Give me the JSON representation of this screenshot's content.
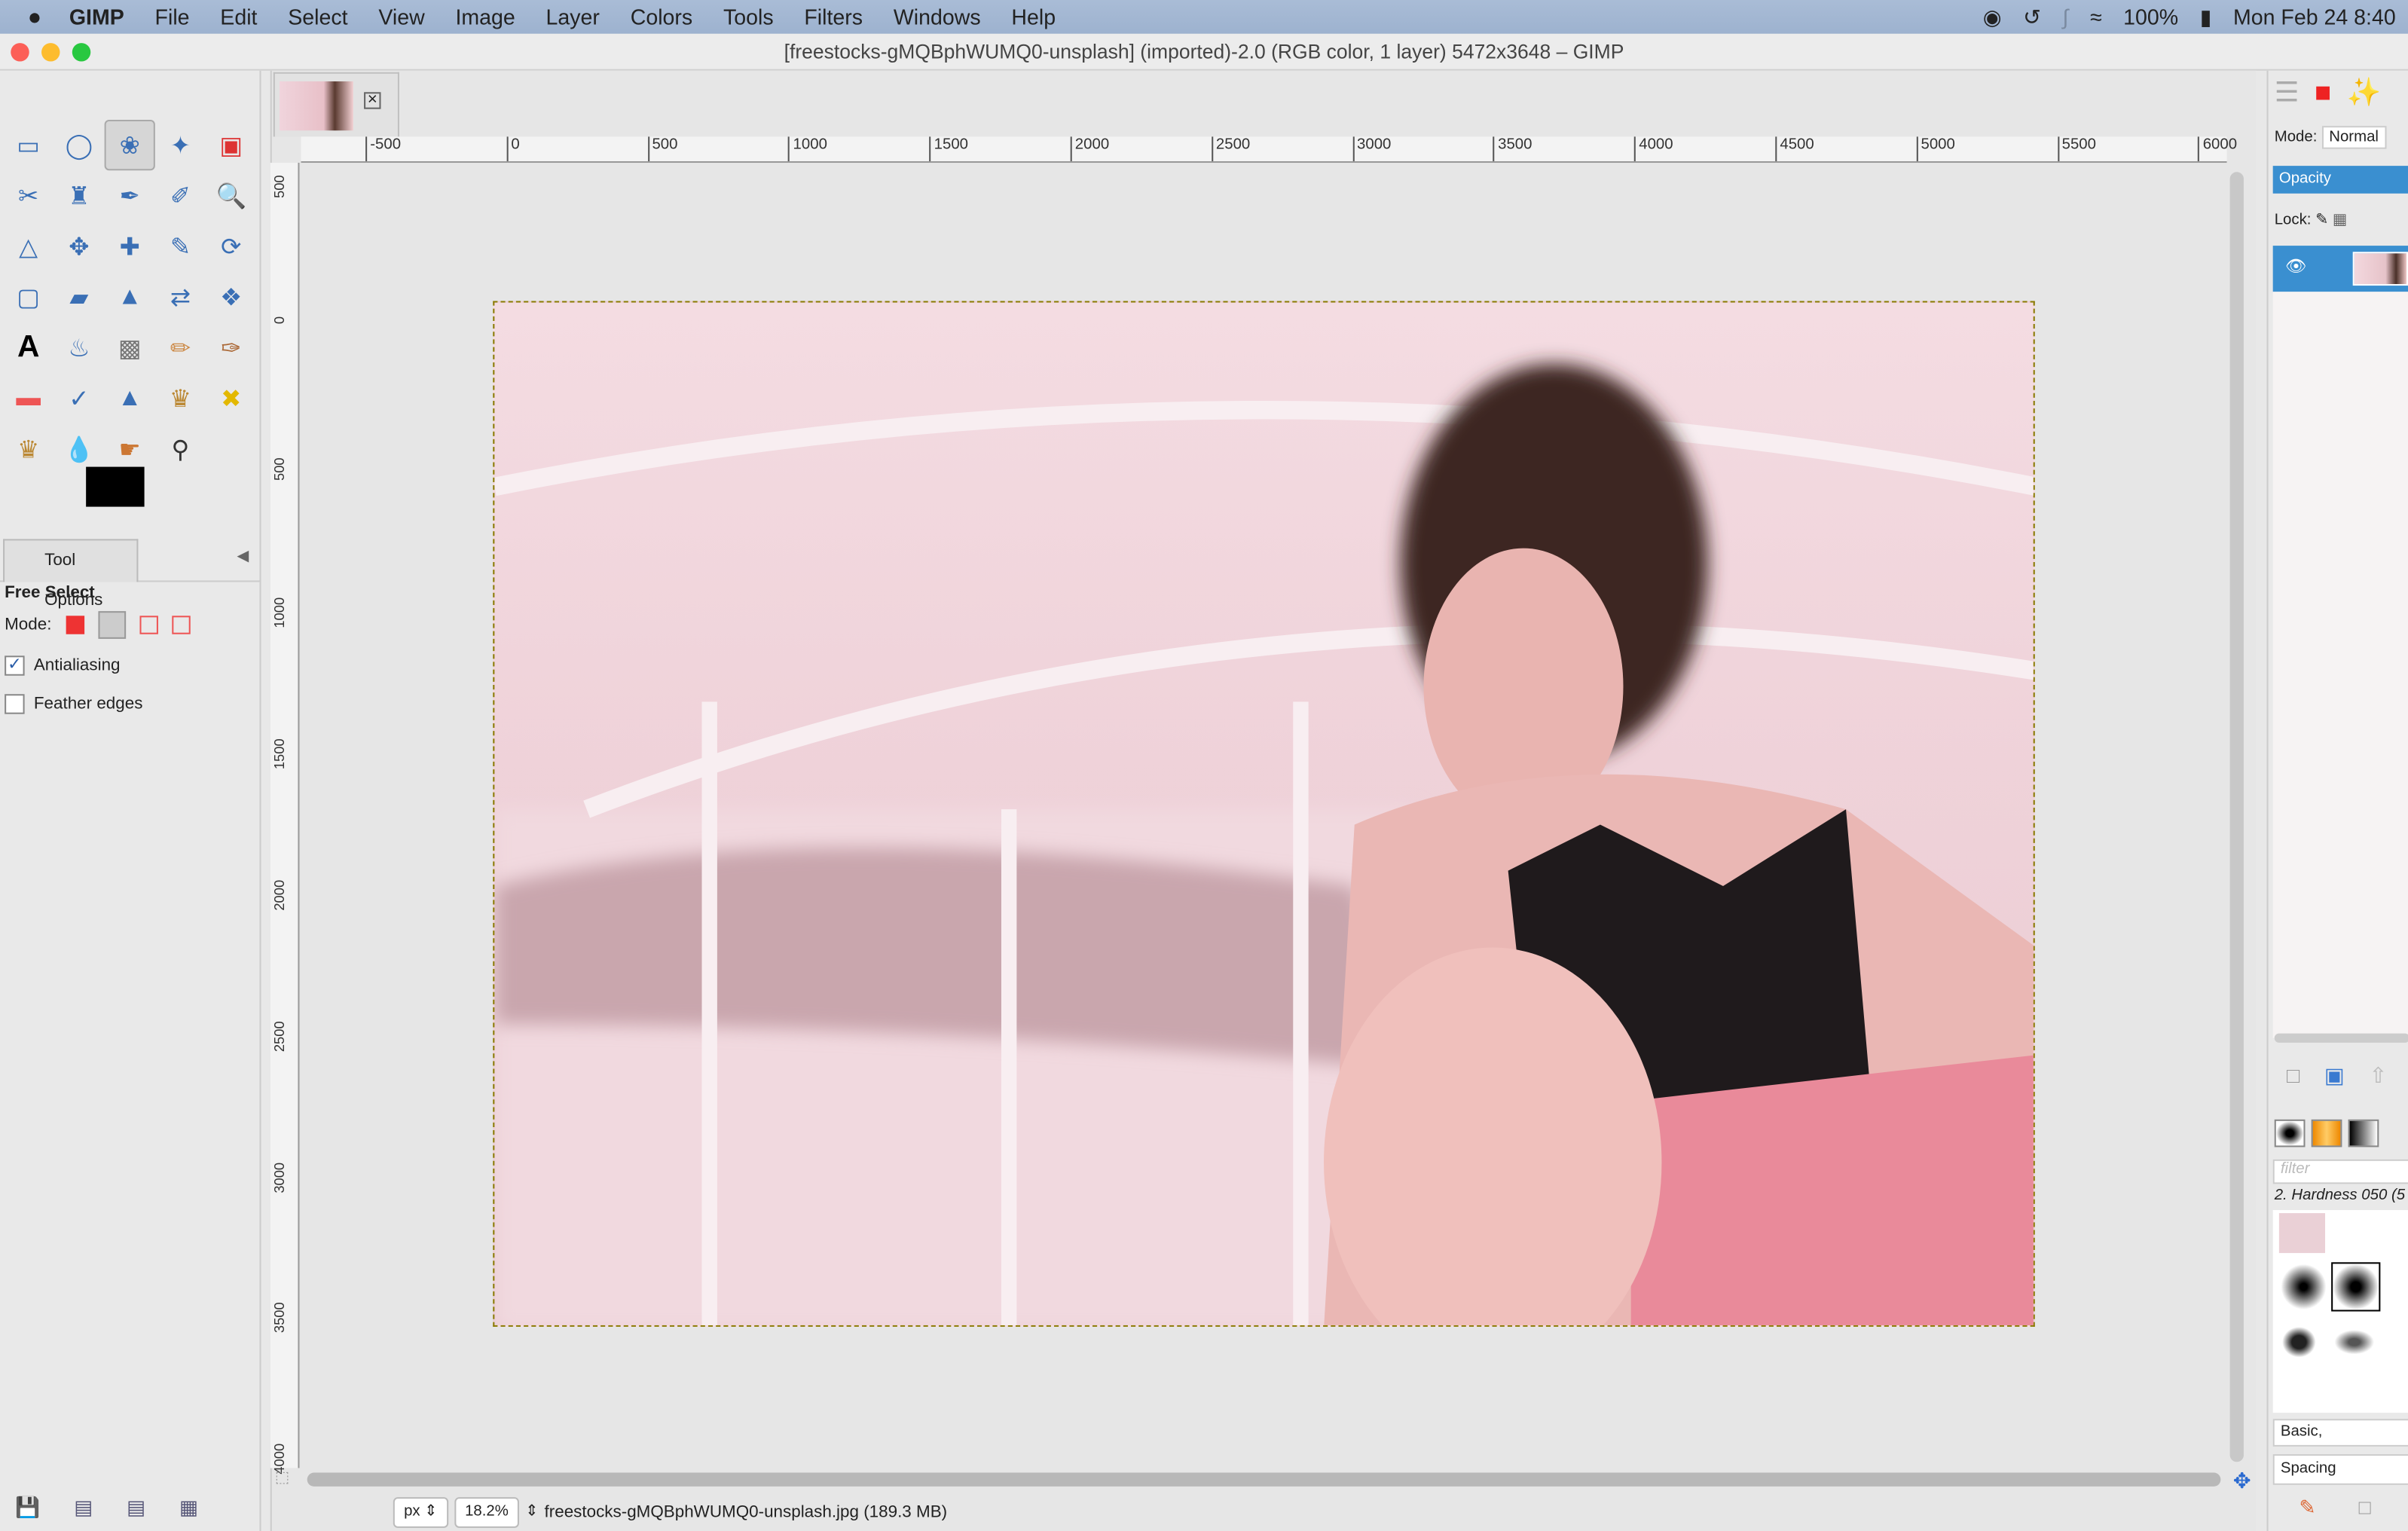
{
  "menubar": {
    "apple": "",
    "app": "GIMP",
    "items": [
      "File",
      "Edit",
      "Select",
      "View",
      "Image",
      "Layer",
      "Colors",
      "Tools",
      "Filters",
      "Windows",
      "Help"
    ],
    "battery": "100%",
    "clock": "Mon Feb 24  8:40"
  },
  "window": {
    "title": "[freestocks-gMQBphWUMQ0-unsplash] (imported)-2.0 (RGB color, 1 layer) 5472x3648 – GIMP"
  },
  "toolbox": {
    "tab_label": "Tool Options",
    "tool_name": "Free Select",
    "mode_label": "Mode:",
    "antialiasing": {
      "label": "Antialiasing",
      "checked": true
    },
    "feather": {
      "label": "Feather edges",
      "checked": false
    },
    "fg_color": "#000000",
    "bg_color": "#ffffff"
  },
  "ruler": {
    "h_labels": [
      "-500",
      "0",
      "500",
      "1000",
      "1500",
      "2000",
      "2500",
      "3000",
      "3500",
      "4000",
      "4500",
      "5000",
      "5500",
      "6000"
    ],
    "v_labels": [
      "500",
      "0",
      "500",
      "1000",
      "1500",
      "2000",
      "2500",
      "3000",
      "3500",
      "4000"
    ]
  },
  "status": {
    "unit": "px",
    "zoom": "18.2%",
    "file": "freestocks-gMQBphWUMQ0-unsplash.jpg (189.3 MB)"
  },
  "layers": {
    "mode_label": "Mode:",
    "mode": "Normal",
    "opacity": "Opacity",
    "lock": "Lock:"
  },
  "brushes": {
    "filter_placeholder": "filter",
    "brush_name": "2. Hardness 050 (5",
    "preset": "Basic,",
    "spacing": "Spacing"
  },
  "colors": {
    "accent": "#3a8fd0"
  }
}
